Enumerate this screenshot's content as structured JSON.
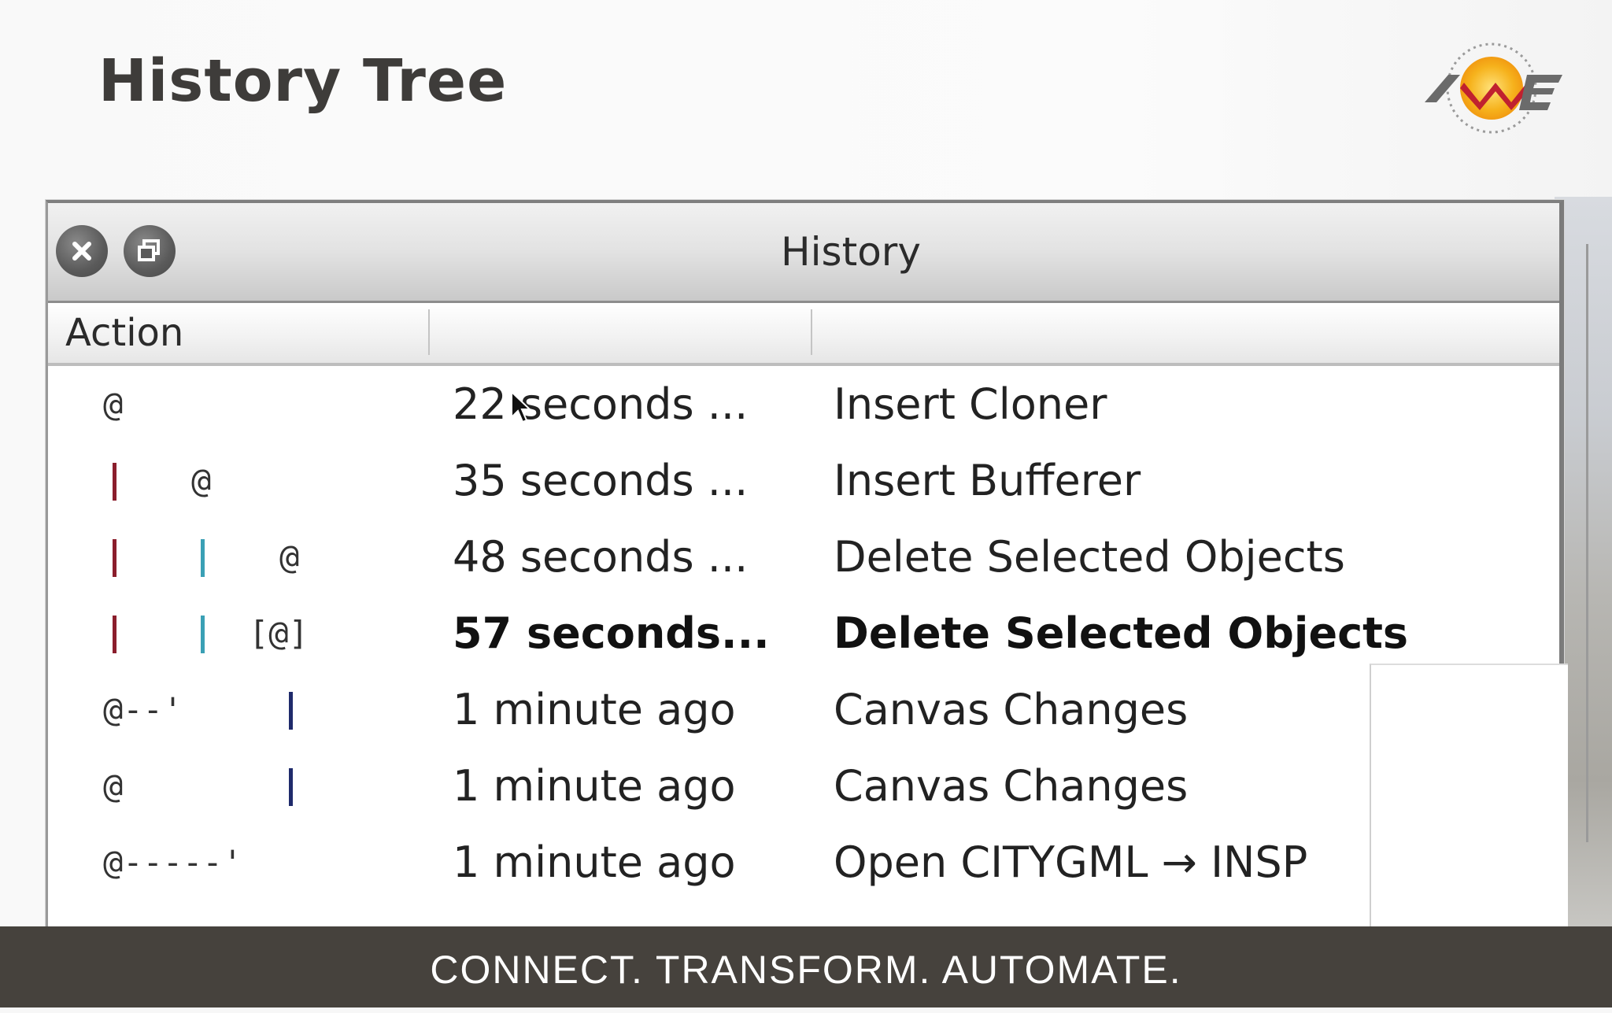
{
  "slide": {
    "title": "History Tree",
    "tagline": "CONNECT. TRANSFORM. AUTOMATE.",
    "logo_text": "FME"
  },
  "window": {
    "title": "History",
    "close_icon": "close-icon",
    "restore_icon": "restore-icon"
  },
  "columns": {
    "action": "Action",
    "time": "",
    "description": ""
  },
  "rows": [
    {
      "tree": "@",
      "time": "22 seconds ...",
      "description": "Insert Cloner",
      "current": false
    },
    {
      "tree": "|   @",
      "time": "35 seconds ...",
      "description": "Insert Bufferer",
      "current": false
    },
    {
      "tree": "|   |   @",
      "time": "48 seconds ...",
      "description": "Delete Selected Objects",
      "current": false
    },
    {
      "tree": "|   |  [@]",
      "time": "57 seconds...",
      "description": "Delete Selected Objects",
      "current": true
    },
    {
      "tree": "@--'    |",
      "time": "1 minute ago",
      "description": "Canvas Changes",
      "current": false
    },
    {
      "tree": "@       |",
      "time": "1 minute ago",
      "description": "Canvas Changes",
      "current": false
    },
    {
      "tree": "@-----'",
      "time": "1 minute ago",
      "description": "Open CITYGML → INSP",
      "current": false
    }
  ],
  "colors": {
    "branch_red": "#8b1e2c",
    "branch_teal": "#3aa0b5",
    "branch_navy": "#1f2a6b",
    "footer": "#46423d"
  }
}
